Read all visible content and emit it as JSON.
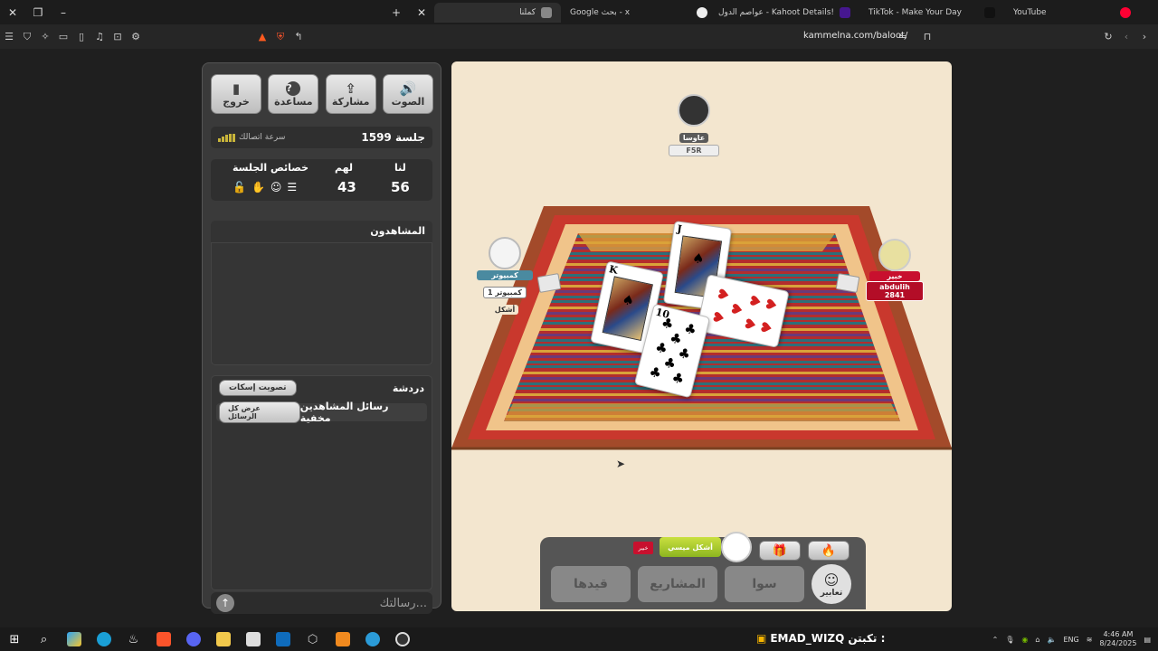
{
  "browser": {
    "tabs": [
      {
        "title": "YouTube",
        "color": "#ff0033",
        "active": false
      },
      {
        "title": "TikTok - Make Your Day",
        "color": "#111111",
        "active": false
      },
      {
        "title": "عواصم الدول - Kahoot Details!",
        "color": "#46178f",
        "active": false
      },
      {
        "title": "Google بحث - x",
        "color": "#ffffff",
        "active": false
      },
      {
        "title": "كملنا",
        "color": "#888888",
        "active": true
      }
    ],
    "url": "kammelna.com/baloot/"
  },
  "panel": {
    "buttons": [
      {
        "label": "الصوت",
        "icon": "🔊"
      },
      {
        "label": "مشاركة",
        "icon": "⇪"
      },
      {
        "label": "مساعدة",
        "icon": "?"
      },
      {
        "label": "خروج",
        "icon": "▮"
      }
    ],
    "session": "جلسة 1599",
    "connection_speed": "سرعة اتصالك",
    "score": {
      "us_label": "لنا",
      "them_label": "لهم",
      "us": "56",
      "them": "43",
      "props_label": "خصائص الجلسة"
    },
    "watchers_title": "المشاهدون",
    "chat": {
      "title": "دردشة",
      "mute_vote": "تصويت إسكات",
      "hidden_msgs": "رسائل المشاهدين مخفية",
      "show_all": "عرض كل الرسائل",
      "placeholder": "رسالتك..."
    }
  },
  "game": {
    "players": {
      "top": {
        "name": "عاوسا",
        "tag": "F5R"
      },
      "left": {
        "name": "كمبيوتر",
        "tag": "كمبيوتر 1",
        "sub": "أشكل"
      },
      "right": {
        "name": "خبير",
        "tag": "abdulih 2841"
      }
    },
    "played_cards": [
      {
        "rank": "J",
        "suit": "♠",
        "color": "#000000"
      },
      {
        "rank": "K",
        "suit": "♠",
        "color": "#000000"
      },
      {
        "rank": "7",
        "suit": "♥",
        "color": "#d32020"
      },
      {
        "rank": "10",
        "suit": "♣",
        "color": "#000000"
      }
    ],
    "controls": {
      "turn_badge": "أشكل ميسي",
      "flag": "خبير",
      "qaydha": "قيدها",
      "projects": "المشاريع",
      "sawa": "سوا",
      "emotes": "تعابير"
    }
  },
  "taskbar": {
    "ticker_label": "تكبتن :",
    "ticker_name": "EMAD_WIZQ",
    "lang": "ENG",
    "time": "4:46 AM",
    "date": "8/24/2025"
  }
}
